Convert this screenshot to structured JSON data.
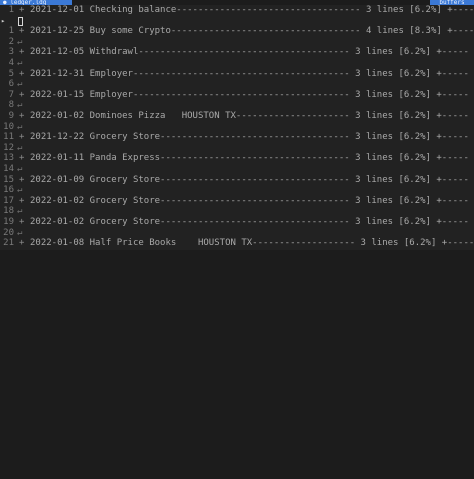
{
  "tabs": {
    "left_label": "● ledger.ldg",
    "right_label": "buffers"
  },
  "markers": {
    "fold": "+",
    "trailing": "↵"
  },
  "lines": [
    {
      "num": "1",
      "type": "fold",
      "text": "2021-12-01 Checking balance---------------------------------- 3 lines [6.2%] +-----"
    },
    {
      "num": "",
      "type": "cursor",
      "sign": "▸"
    },
    {
      "num": "1",
      "type": "fold",
      "text": "2021-12-25 Buy some Crypto----------------------------------- 4 lines [8.3%] +-----"
    },
    {
      "num": "2",
      "type": "empty"
    },
    {
      "num": "3",
      "type": "fold",
      "text": "2021-12-05 Withdrawl--------------------------------------- 3 lines [6.2%] +-----"
    },
    {
      "num": "4",
      "type": "empty"
    },
    {
      "num": "5",
      "type": "fold",
      "text": "2021-12-31 Employer---------------------------------------- 3 lines [6.2%] +-----"
    },
    {
      "num": "6",
      "type": "empty"
    },
    {
      "num": "7",
      "type": "fold",
      "text": "2022-01-15 Employer---------------------------------------- 3 lines [6.2%] +-----"
    },
    {
      "num": "8",
      "type": "empty"
    },
    {
      "num": "9",
      "type": "fold",
      "text": "2022-01-02 Dominoes Pizza   HOUSTON TX--------------------- 3 lines [6.2%] +-----"
    },
    {
      "num": "10",
      "type": "empty"
    },
    {
      "num": "11",
      "type": "fold",
      "text": "2021-12-22 Grocery Store----------------------------------- 3 lines [6.2%] +-----"
    },
    {
      "num": "12",
      "type": "empty"
    },
    {
      "num": "13",
      "type": "fold",
      "text": "2022-01-11 Panda Express----------------------------------- 3 lines [6.2%] +-----"
    },
    {
      "num": "14",
      "type": "empty"
    },
    {
      "num": "15",
      "type": "fold",
      "text": "2022-01-09 Grocery Store----------------------------------- 3 lines [6.2%] +-----"
    },
    {
      "num": "16",
      "type": "empty"
    },
    {
      "num": "17",
      "type": "fold",
      "text": "2022-01-02 Grocery Store----------------------------------- 3 lines [6.2%] +-----"
    },
    {
      "num": "18",
      "type": "empty"
    },
    {
      "num": "19",
      "type": "fold",
      "text": "2022-01-02 Grocery Store----------------------------------- 3 lines [6.2%] +-----"
    },
    {
      "num": "20",
      "type": "empty"
    },
    {
      "num": "21",
      "type": "fold",
      "text": "2022-01-08 Half Price Books    HOUSTON TX------------------- 3 lines [6.2%] +-----"
    }
  ]
}
